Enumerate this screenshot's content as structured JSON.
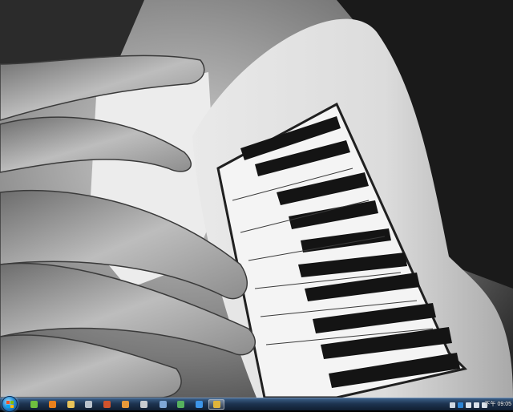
{
  "wallpaper": {
    "subject": "piano-keys-tattoo-photo"
  },
  "taskbar": {
    "start_icon": "windows-orb-icon",
    "pinned": [
      {
        "name": "media-player-icon",
        "color": "#6fbf3f"
      },
      {
        "name": "app-orange-icon",
        "color": "#e8801d"
      },
      {
        "name": "explorer-folder-icon",
        "color": "#e8c35a"
      },
      {
        "name": "app-icon",
        "color": "#b9c2cc"
      },
      {
        "name": "app-red-icon",
        "color": "#d2532c"
      },
      {
        "name": "app-orange2-icon",
        "color": "#e89a3a"
      },
      {
        "name": "app-gray-icon",
        "color": "#c8ccd0"
      },
      {
        "name": "app-blue-icon",
        "color": "#7fa7d6"
      },
      {
        "name": "people-icon",
        "color": "#56b15e"
      },
      {
        "name": "internet-explorer-icon",
        "color": "#3d95e8"
      },
      {
        "name": "window-icon",
        "color": "#9fc2e8"
      },
      {
        "name": "chrome-icon",
        "color": "#e0b43a"
      }
    ],
    "tray": [
      {
        "name": "tray-up-arrow-icon",
        "color": "#cfd8e2"
      },
      {
        "name": "tray-app-icon",
        "color": "#2c84d4"
      },
      {
        "name": "tray-network-icon",
        "color": "#d9e1ea"
      },
      {
        "name": "tray-volume-icon",
        "color": "#d9e1ea"
      },
      {
        "name": "tray-flag-icon",
        "color": "#d9e1ea"
      }
    ],
    "clock": "下午 09:05"
  }
}
